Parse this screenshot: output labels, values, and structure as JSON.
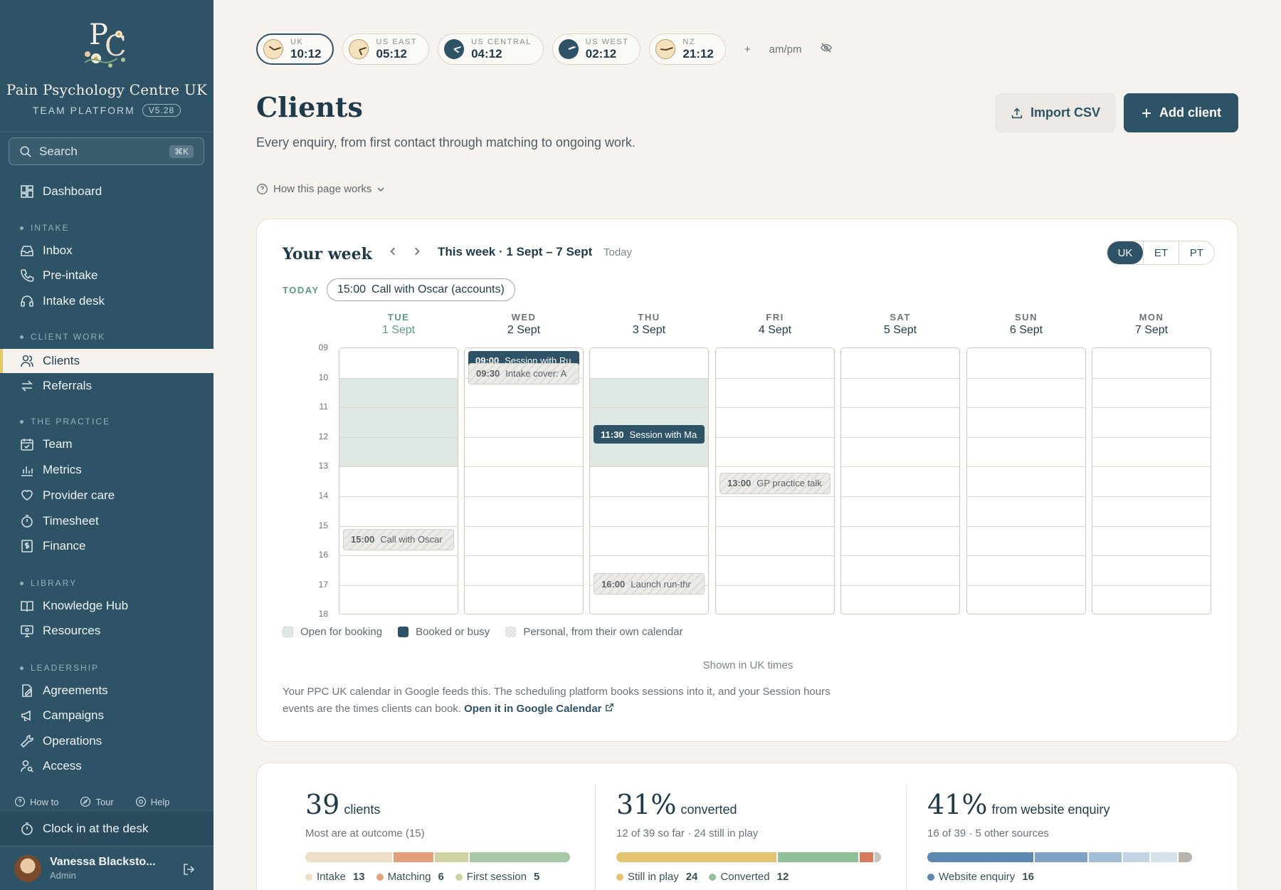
{
  "brand": {
    "name": "Pain Psychology Centre UK",
    "subtitle": "TEAM PLATFORM",
    "version": "V5.28"
  },
  "search": {
    "placeholder": "Search",
    "shortcut": "⌘K"
  },
  "sidebar": {
    "dashboard": "Dashboard",
    "sections": {
      "intake": "INTAKE",
      "client_work": "CLIENT WORK",
      "practice": "THE PRACTICE",
      "library": "LIBRARY",
      "leadership": "LEADERSHIP"
    },
    "items": {
      "inbox": "Inbox",
      "pre_intake": "Pre-intake",
      "intake_desk": "Intake desk",
      "clients": "Clients",
      "referrals": "Referrals",
      "team": "Team",
      "metrics": "Metrics",
      "provider_care": "Provider care",
      "timesheet": "Timesheet",
      "finance": "Finance",
      "knowledge_hub": "Knowledge Hub",
      "resources": "Resources",
      "agreements": "Agreements",
      "campaigns": "Campaigns",
      "operations": "Operations",
      "access": "Access"
    },
    "bottom_links": {
      "how_to": "How to",
      "tour": "Tour",
      "help": "Help"
    },
    "clock_in": "Clock in at the desk",
    "user": {
      "name": "Vanessa Blacksto...",
      "role": "Admin"
    }
  },
  "clocks": [
    {
      "label": "UK",
      "time": "10:12",
      "active": true,
      "face": "day"
    },
    {
      "label": "US EAST",
      "time": "05:12",
      "active": false,
      "face": "day"
    },
    {
      "label": "US CENTRAL",
      "time": "04:12",
      "active": false,
      "face": "night"
    },
    {
      "label": "US WEST",
      "time": "02:12",
      "active": false,
      "face": "night"
    },
    {
      "label": "NZ",
      "time": "21:12",
      "active": false,
      "face": "day"
    }
  ],
  "clock_bar": {
    "add": "+",
    "ampm": "am/pm"
  },
  "page": {
    "title": "Clients",
    "description": "Every enquiry, from first contact through matching to ongoing work.",
    "how_works": "How this page works",
    "import_label": "Import CSV",
    "add_label": "Add client"
  },
  "week": {
    "title": "Your week",
    "range": "This week · 1 Sept – 7 Sept",
    "today_btn": "Today",
    "tz": [
      "UK",
      "ET",
      "PT"
    ],
    "today_label": "TODAY",
    "today_event": {
      "time": "15:00",
      "title": "Call with Oscar (accounts)"
    },
    "days": [
      {
        "name": "TUE",
        "date": "1 Sept",
        "current": true
      },
      {
        "name": "WED",
        "date": "2 Sept"
      },
      {
        "name": "THU",
        "date": "3 Sept"
      },
      {
        "name": "FRI",
        "date": "4 Sept"
      },
      {
        "name": "SAT",
        "date": "5 Sept"
      },
      {
        "name": "SUN",
        "date": "6 Sept"
      },
      {
        "name": "MON",
        "date": "7 Sept"
      }
    ],
    "hours": [
      "09",
      "10",
      "11",
      "12",
      "13",
      "14",
      "15",
      "16",
      "17",
      "18"
    ],
    "events": {
      "tue_call": {
        "time": "15:00",
        "title": "Call with Oscar"
      },
      "wed_session": {
        "time": "09:00",
        "title": "Session with Ru"
      },
      "wed_intake": {
        "time": "09:30",
        "title": "Intake cover: A"
      },
      "thu_session": {
        "time": "11:30",
        "title": "Session with Ma"
      },
      "thu_launch": {
        "time": "16:00",
        "title": "Launch run-thr"
      },
      "fri_gp": {
        "time": "13:00",
        "title": "GP practice talk"
      }
    },
    "legend": {
      "open": "Open for booking",
      "busy": "Booked or busy",
      "personal": "Personal, from their own calendar"
    },
    "shown_in": "Shown in UK times",
    "note": "Your PPC UK calendar in Google feeds this. The scheduling platform books sessions into it, and your Session hours events are the times clients can book.",
    "note_link": "Open it in Google Calendar"
  },
  "stats": [
    {
      "big": "39",
      "word": "clients",
      "sub": "Most are at outcome (15)",
      "segments": [
        {
          "value": 13,
          "color": "#ecdfc6"
        },
        {
          "value": 6,
          "color": "#e4a07a"
        },
        {
          "value": 5,
          "color": "#cfd3a4"
        },
        {
          "value": 15,
          "color": "#a8c9a8"
        }
      ],
      "legend": [
        {
          "label": "Intake",
          "value": "13",
          "color": "#ecdfc6"
        },
        {
          "label": "Matching",
          "value": "6",
          "color": "#e4a07a"
        },
        {
          "label": "First session",
          "value": "5",
          "color": "#cfd3a4"
        }
      ]
    },
    {
      "big": "31%",
      "word": "converted",
      "sub": "12 of 39 so far · 24 still in play",
      "segments": [
        {
          "value": 24,
          "color": "#e3c470"
        },
        {
          "value": 12,
          "color": "#8fc09a"
        },
        {
          "value": 2,
          "color": "#d87a5c"
        },
        {
          "value": 1,
          "color": "#c9c4bb"
        }
      ],
      "legend": [
        {
          "label": "Still in play",
          "value": "24",
          "color": "#e3c470"
        },
        {
          "label": "Converted",
          "value": "12",
          "color": "#8fc09a"
        }
      ]
    },
    {
      "big": "41%",
      "word": "from website enquiry",
      "sub": "16 of 39 · 5 other sources",
      "segments": [
        {
          "value": 16,
          "color": "#5a88b0"
        },
        {
          "value": 8,
          "color": "#7ea3c4"
        },
        {
          "value": 5,
          "color": "#a3bfd7"
        },
        {
          "value": 4,
          "color": "#c3d5e4"
        },
        {
          "value": 4,
          "color": "#d5e2ec"
        },
        {
          "value": 2,
          "color": "#b8b3aa"
        }
      ],
      "legend": [
        {
          "label": "Website enquiry",
          "value": "16",
          "color": "#5a88b0"
        }
      ]
    }
  ],
  "colors": {
    "accent": "#2e5266",
    "open_slot": "#dfe9e3",
    "highlight": "#5b9a8a"
  }
}
